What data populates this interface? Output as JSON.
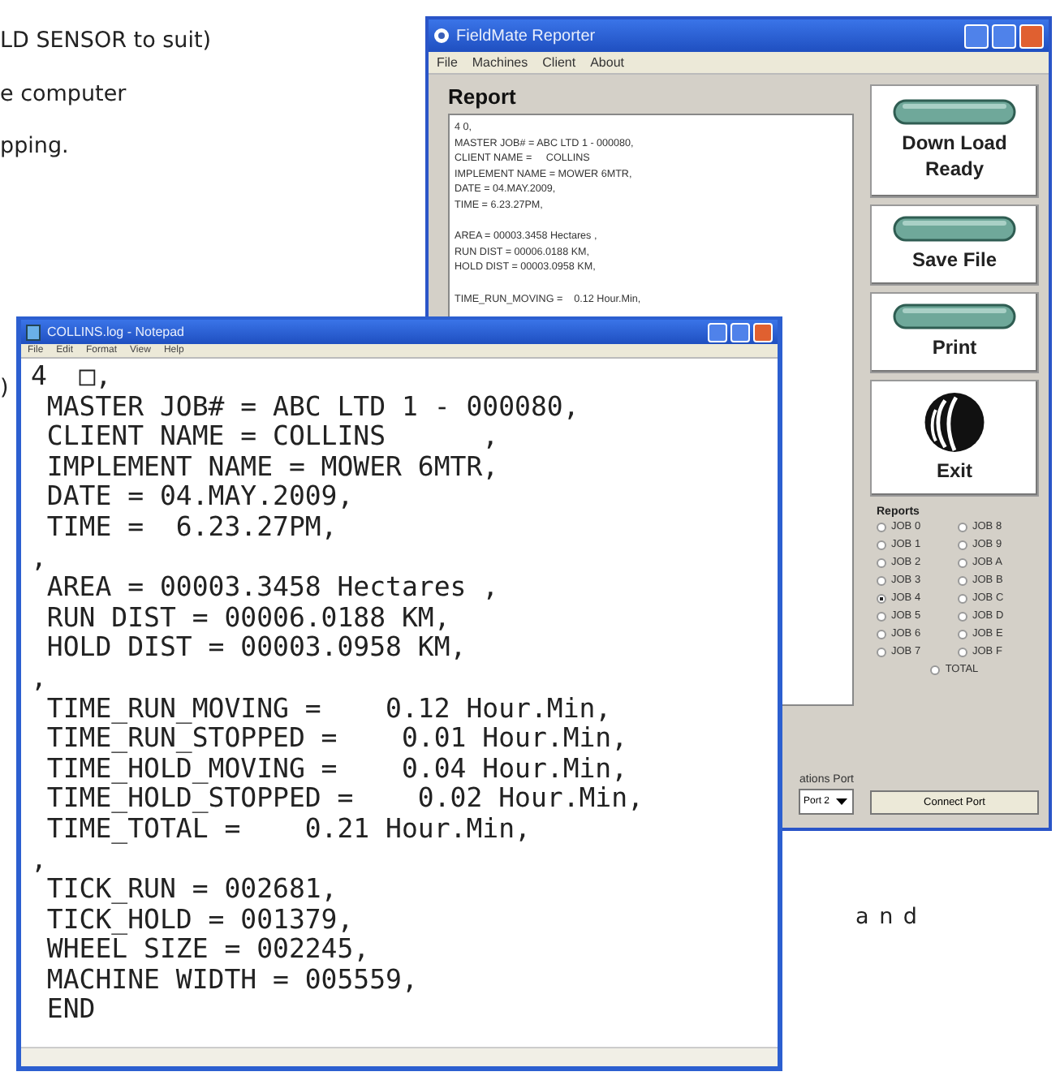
{
  "page_text": [
    {
      "text": "LD SENSOR to suit)"
    },
    {
      "text": "e computer"
    },
    {
      "text": "pping."
    },
    {
      "text": ")"
    },
    {
      "text": "a n d"
    }
  ],
  "reporter": {
    "title": "FieldMate Reporter",
    "menu": [
      "File",
      "Machines",
      "Client",
      "About"
    ],
    "report_heading": "Report",
    "report_blocks": [
      [
        "4 0,",
        "MASTER JOB# = ABC LTD 1 - 000080,",
        "CLIENT NAME =     COLLINS",
        "IMPLEMENT NAME = MOWER 6MTR,",
        "DATE = 04.MAY.2009,",
        "TIME = 6.23.27PM,"
      ],
      [
        "AREA = 00003.3458 Hectares ,",
        "RUN DIST = 00006.0188 KM,",
        "HOLD DIST = 00003.0958 KM,"
      ],
      [
        "TIME_RUN_MOVING =    0.12 Hour.Min,"
      ]
    ],
    "buttons": [
      {
        "kind": "indicator",
        "label": "Down Load Ready"
      },
      {
        "kind": "indicator",
        "label": "Save File"
      },
      {
        "kind": "indicator",
        "label": "Print"
      },
      {
        "kind": "logo",
        "label": "Exit"
      }
    ],
    "reports": {
      "title": "Reports",
      "options": [
        {
          "label": "JOB 0",
          "selected": false
        },
        {
          "label": "JOB 1",
          "selected": false
        },
        {
          "label": "JOB 2",
          "selected": false
        },
        {
          "label": "JOB 3",
          "selected": false
        },
        {
          "label": "JOB 4",
          "selected": true
        },
        {
          "label": "JOB 5",
          "selected": false
        },
        {
          "label": "JOB 6",
          "selected": false
        },
        {
          "label": "JOB 7",
          "selected": false
        },
        {
          "label": "JOB 8",
          "selected": false
        },
        {
          "label": "JOB 9",
          "selected": false
        },
        {
          "label": "JOB A",
          "selected": false
        },
        {
          "label": "JOB B",
          "selected": false
        },
        {
          "label": "JOB C",
          "selected": false
        },
        {
          "label": "JOB D",
          "selected": false
        },
        {
          "label": "JOB E",
          "selected": false
        },
        {
          "label": "JOB F",
          "selected": false
        },
        {
          "label": "TOTAL",
          "selected": false
        }
      ]
    },
    "port_label": "ations Port",
    "port_value": "Port 2",
    "connect_button": "Connect Port"
  },
  "notepad": {
    "title": "COLLINS.log - Notepad",
    "menu": [
      "File",
      "Edit",
      "Format",
      "View",
      "Help"
    ],
    "lines": [
      "4  □,",
      " MASTER JOB# = ABC LTD 1 - 000080,",
      " CLIENT NAME = COLLINS      ,",
      " IMPLEMENT NAME = MOWER 6MTR,",
      " DATE = 04.MAY.2009,",
      " TIME =  6.23.27PM,",
      ",",
      " AREA = 00003.3458 Hectares ,",
      " RUN DIST = 00006.0188 KM,",
      " HOLD DIST = 00003.0958 KM,",
      ",",
      " TIME_RUN_MOVING =    0.12 Hour.Min,",
      " TIME_RUN_STOPPED =    0.01 Hour.Min,",
      " TIME_HOLD_MOVING =    0.04 Hour.Min,",
      " TIME_HOLD_STOPPED =    0.02 Hour.Min,",
      " TIME_TOTAL =    0.21 Hour.Min,",
      ",",
      " TICK_RUN = 002681,",
      " TICK_HOLD = 001379,",
      " WHEEL SIZE = 002245,",
      " MACHINE WIDTH = 005559,",
      " END"
    ]
  }
}
